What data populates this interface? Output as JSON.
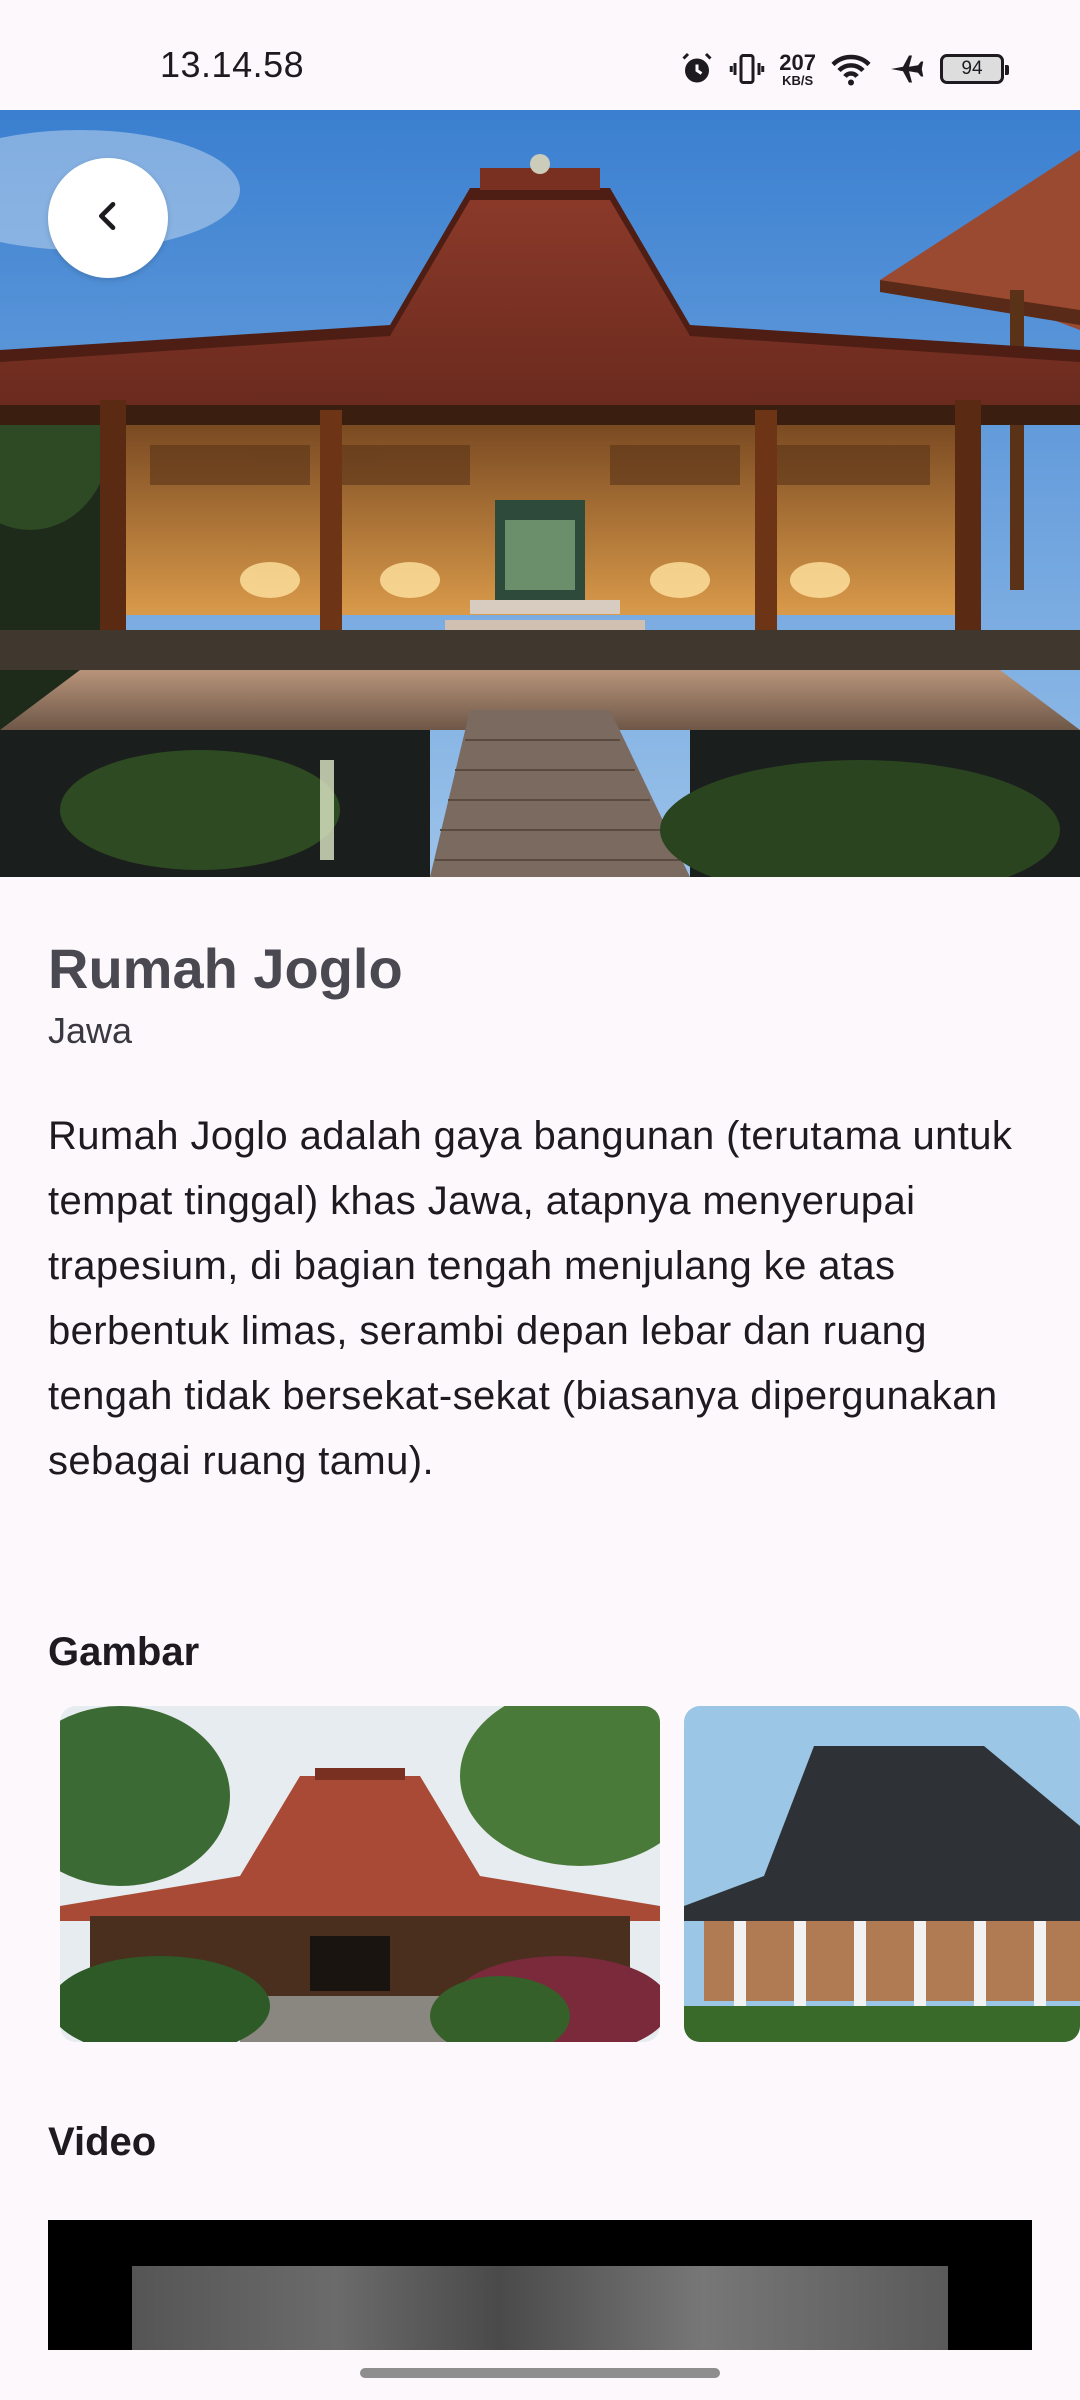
{
  "status_bar": {
    "time": "13.14.58",
    "net_speed_value": "207",
    "net_speed_unit": "KB/S",
    "battery": "94",
    "icons": [
      "alarm-icon",
      "vibrate-icon",
      "wifi-icon",
      "airplane-icon",
      "battery-icon"
    ]
  },
  "header": {
    "back_icon": "chevron-left-icon"
  },
  "detail": {
    "title": "Rumah Joglo",
    "region": "Jawa",
    "description": "Rumah Joglo adalah gaya bangunan (terutama untuk tempat tinggal) khas Jawa, atapnya menyerupai trapesium, di bagian tengah menjulang ke atas berbentuk limas, serambi depan lebar dan ruang tengah tidak bersekat-sekat (biasanya dipergunakan sebagai ruang tamu)."
  },
  "gallery": {
    "label": "Gambar"
  },
  "video": {
    "label": "Video"
  }
}
